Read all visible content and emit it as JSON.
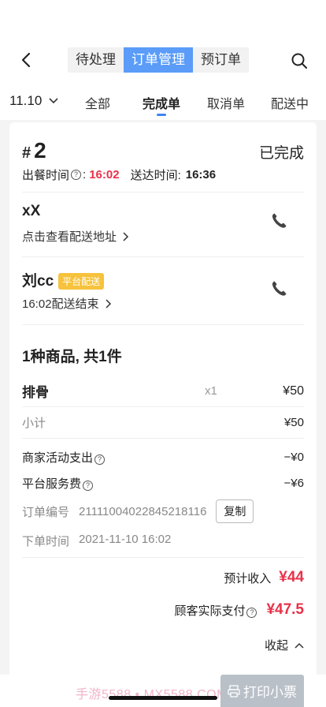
{
  "header": {
    "tabs": [
      "待处理",
      "订单管理",
      "预订单"
    ],
    "active_tab": 1
  },
  "date_selector": {
    "label": "11.10"
  },
  "status_tabs": [
    "全部",
    "完成单",
    "取消单",
    "配送中"
  ],
  "order": {
    "number_prefix": "#",
    "number": "2",
    "status": "已完成",
    "meal_time_label": "出餐时间",
    "meal_time": "16:02",
    "delivery_time_label": "送达时间:",
    "delivery_time": "16:36",
    "customer_name": "xX",
    "address_link": "点击查看配送地址",
    "rider_name": "刘cc",
    "rider_badge": "平台配送",
    "rider_status": "16:02配送结束",
    "goods_summary": "1种商品, 共1件",
    "item": {
      "name": "排骨",
      "qty": "x1",
      "price": "¥50"
    },
    "subtotal_label": "小计",
    "subtotal": "¥50",
    "merchant_promo_label": "商家活动支出",
    "merchant_promo": "−¥0",
    "service_fee_label": "平台服务费",
    "service_fee": "−¥6",
    "order_id_label": "订单编号",
    "order_id": "21111004022845218116",
    "copy_label": "复制",
    "order_time_label": "下单时间",
    "order_time": "2021-11-10 16:02",
    "est_income_label": "预计收入",
    "est_income": "¥44",
    "paid_label": "顾客实际支付",
    "paid": "¥47.5",
    "collapse_label": "收起"
  },
  "bottom": {
    "watermark": "手游5588 • MX5588.COM",
    "print_label": "打印小票"
  }
}
